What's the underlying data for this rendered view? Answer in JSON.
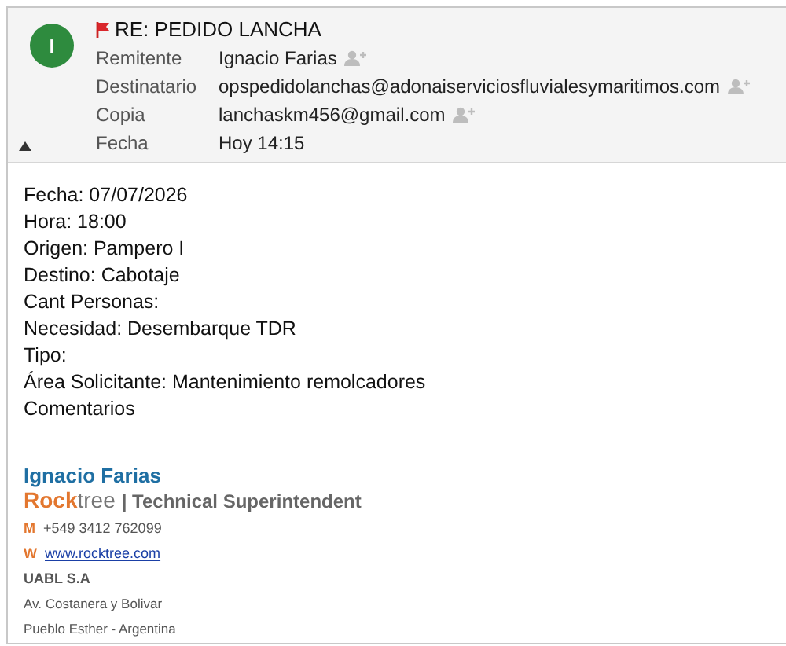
{
  "header": {
    "avatar": "I",
    "flagged": true,
    "subject": "RE: PEDIDO LANCHA",
    "collapsed": false,
    "fields": [
      {
        "label": "Remitente",
        "value": "Ignacio Farias",
        "add_contact": true
      },
      {
        "label": "Destinatario",
        "value": "opspedidolanchas@adonaiserviciosfluvialesymaritimos.com",
        "add_contact": true
      },
      {
        "label": "Copia",
        "value": "lanchaskm456@gmail.com",
        "add_contact": true
      },
      {
        "label": "Fecha",
        "value": "Hoy 14:15",
        "add_contact": false
      }
    ]
  },
  "body": [
    "Fecha: 07/07/2026",
    "Hora: 18:00",
    "Origen: Pampero I",
    "Destino: Cabotaje",
    "Cant Personas:",
    "Necesidad: Desembarque TDR",
    "Tipo:",
    "Área Solicitante: Mantenimiento remolcadores",
    "Comentarios"
  ],
  "signature": {
    "name": "Ignacio Farias",
    "brand": "**Rock**tree",
    "role": "| Technical Superintendent",
    "contacts": [
      {
        "key": "M",
        "value": "+549 3412 762099",
        "kind": "phone"
      },
      {
        "key": "W",
        "value": "www.rocktree.com",
        "kind": "link"
      }
    ],
    "company": "UABL S.A",
    "address": [
      "Av. Costanera y Bolivar",
      "Pueblo Esther - Argentina"
    ]
  }
}
